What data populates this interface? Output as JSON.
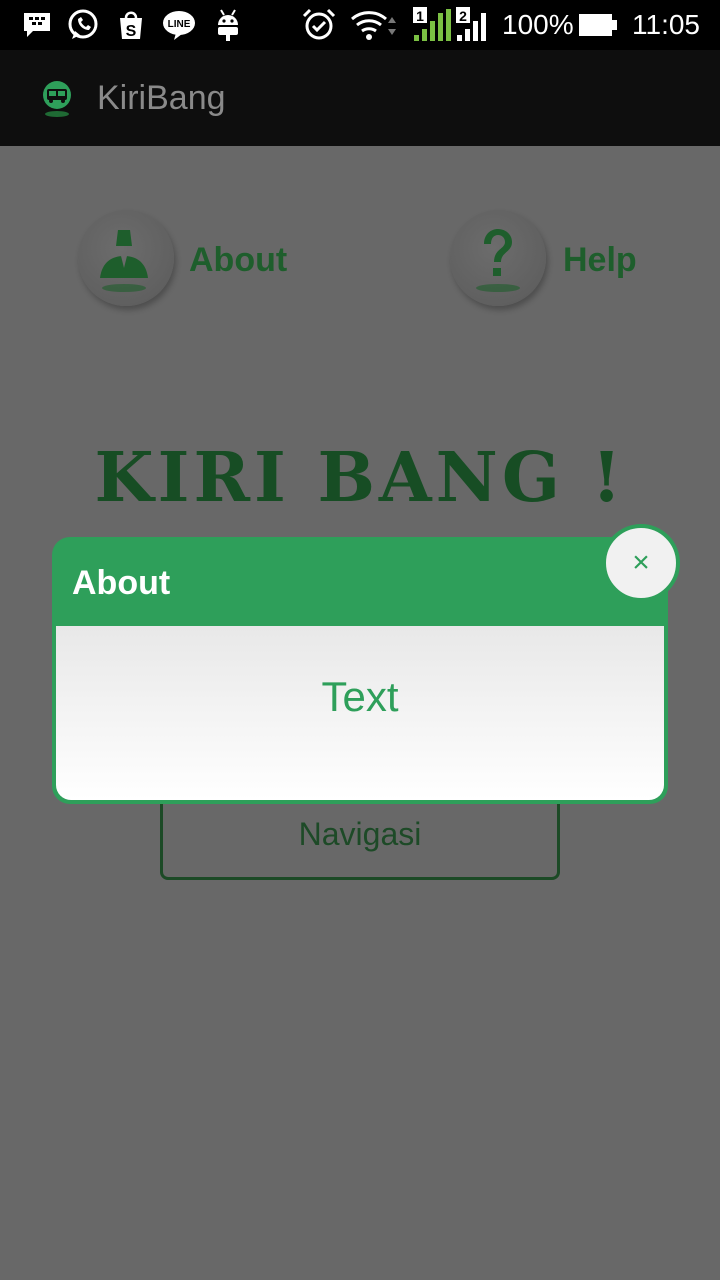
{
  "status_bar": {
    "battery": "100%",
    "time": "11:05",
    "sim1": "1",
    "sim2": "2",
    "notification_icons": [
      "bbm-icon",
      "whatsapp-icon",
      "shopee-icon",
      "line-icon",
      "android-debug-icon"
    ],
    "status_icons": [
      "alarm-icon",
      "wifi-icon",
      "signal-sim1-icon",
      "signal-sim2-icon",
      "battery-icon"
    ]
  },
  "app_bar": {
    "title": "KiriBang",
    "logo_icon": "bus-stop-logo-icon"
  },
  "main": {
    "about_label": "About",
    "help_label": "Help",
    "hero_title": "KIRI BANG !",
    "navigate_label": "Navigasi"
  },
  "dialog": {
    "title": "About",
    "body_text": "Text",
    "close_label": "×"
  },
  "colors": {
    "accent_green": "#2e9f5a",
    "dark_green": "#174d24",
    "scrim": "#686868"
  }
}
